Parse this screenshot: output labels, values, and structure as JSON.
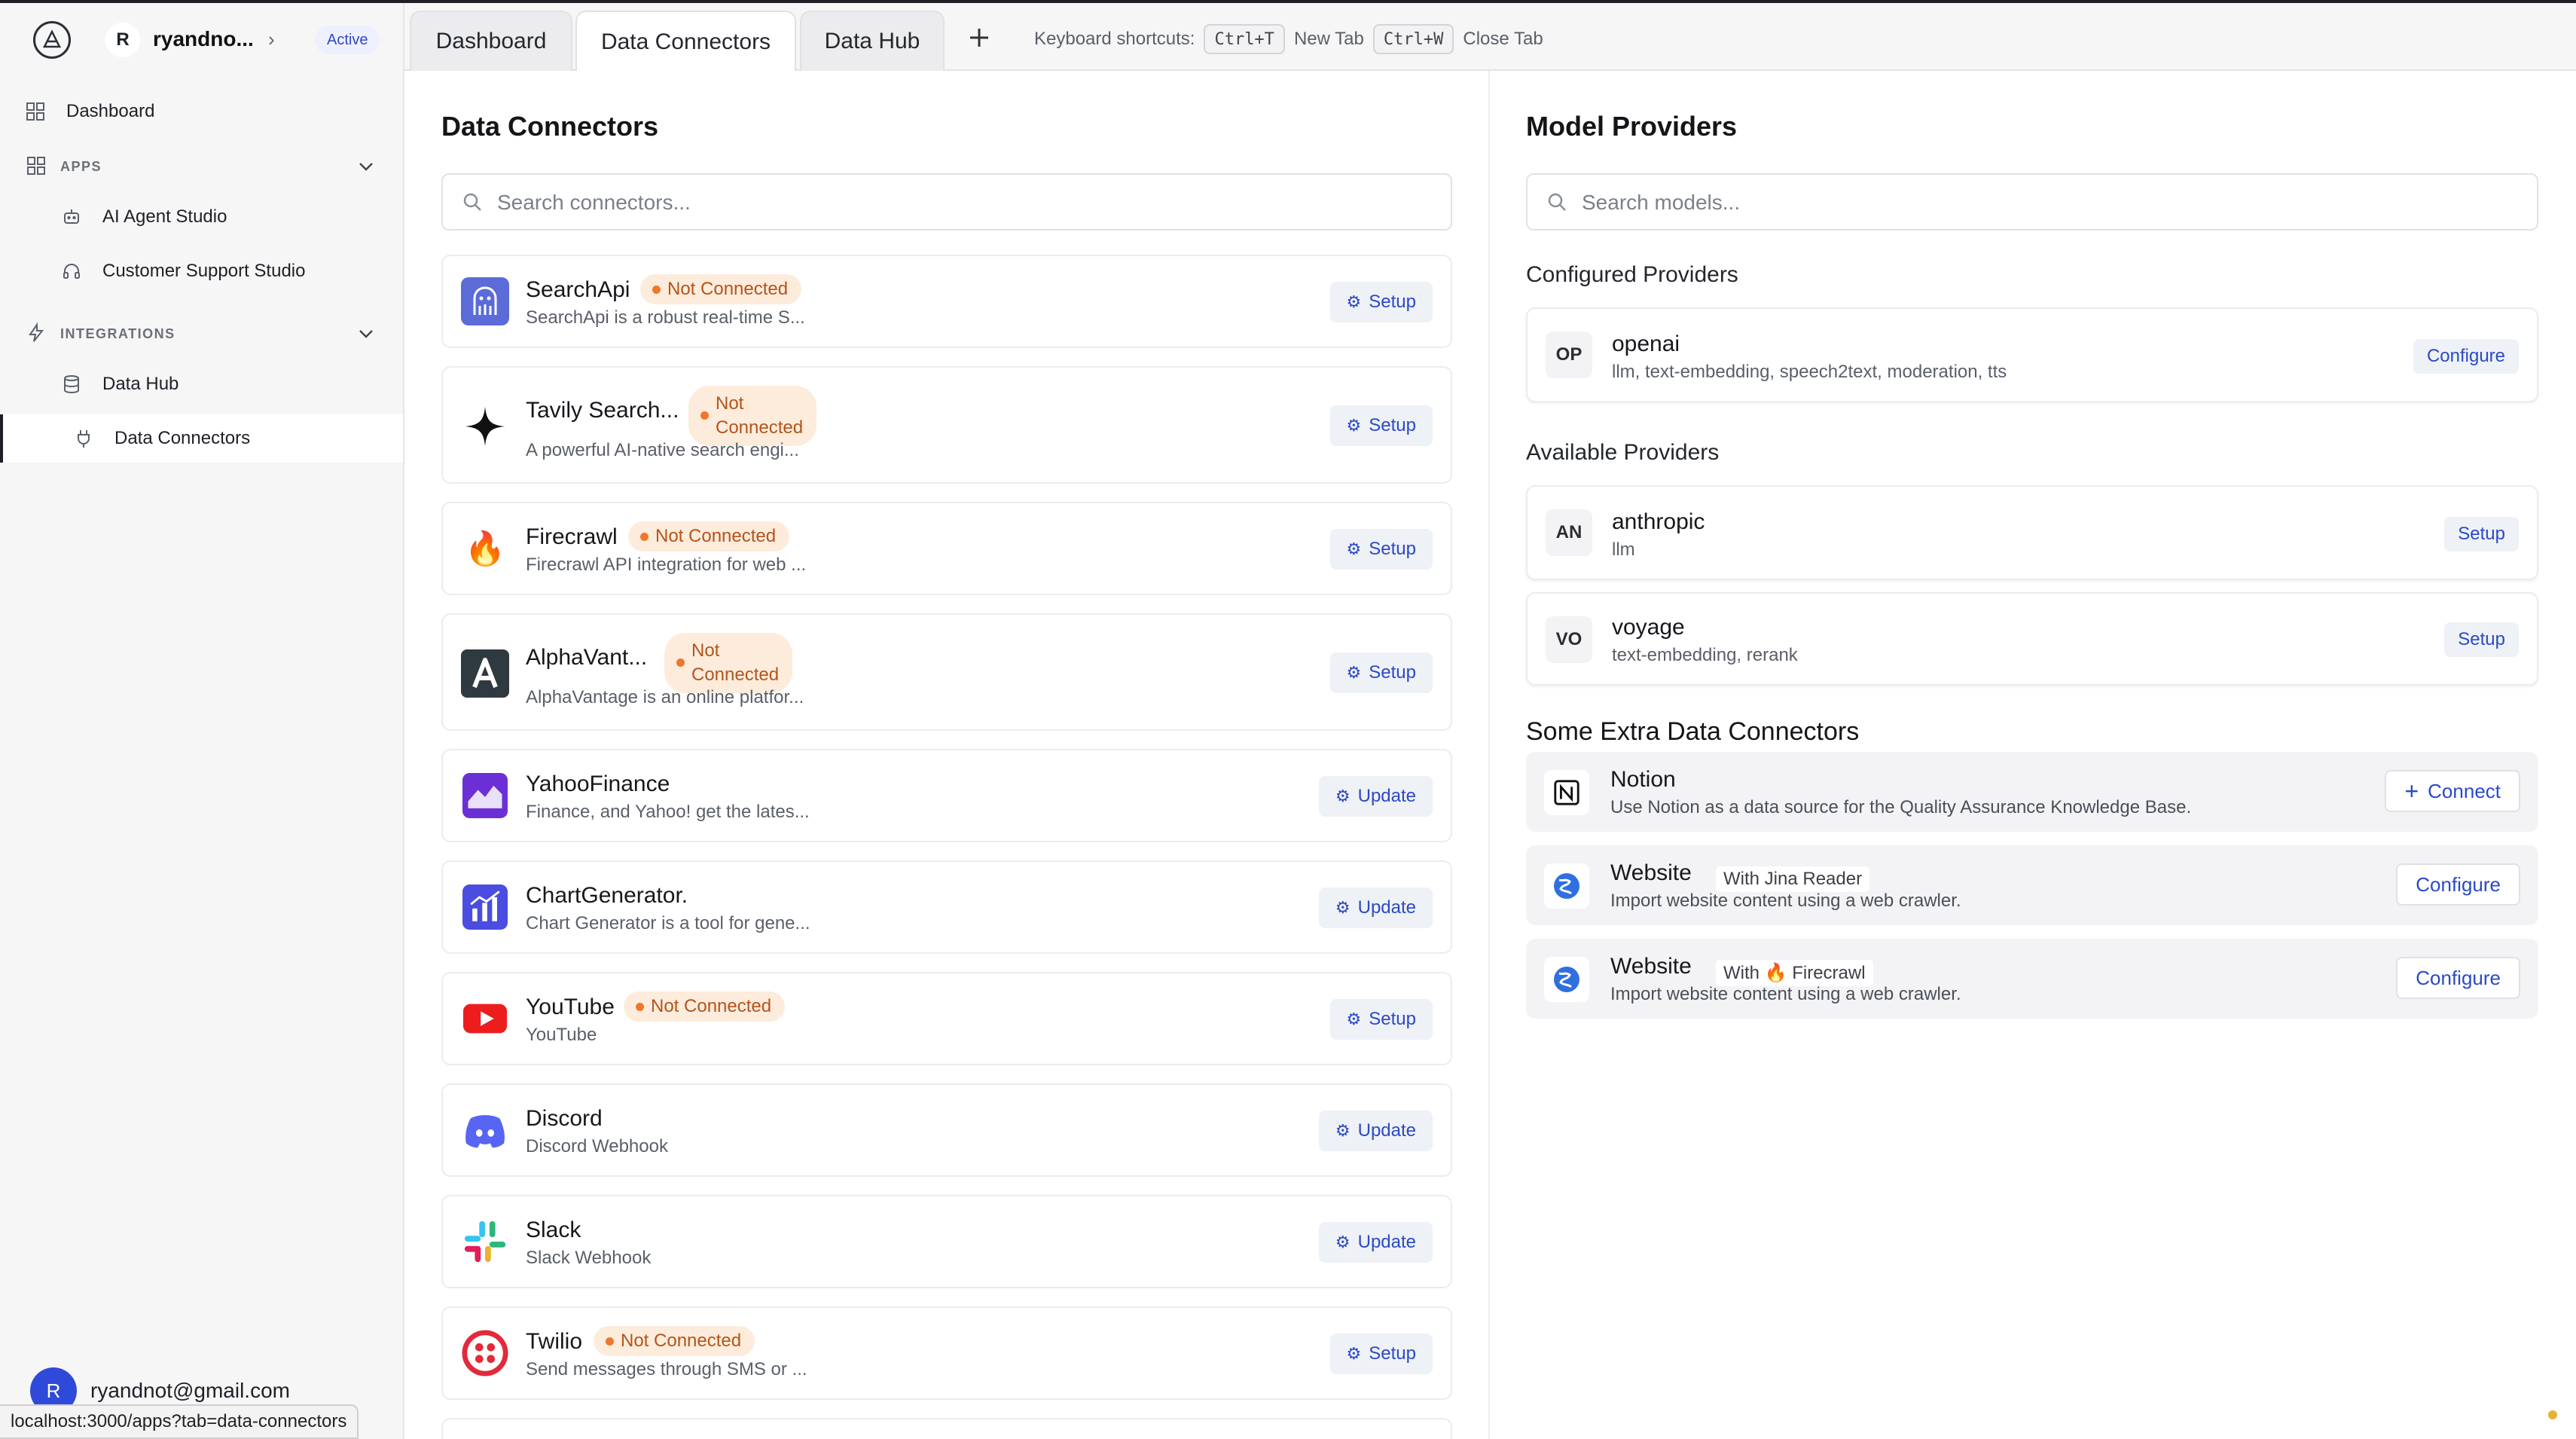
{
  "workspace": {
    "initial": "R",
    "name": "ryandno...",
    "status": "Active"
  },
  "sidebar": {
    "dashboard": "Dashboard",
    "apps_section": "APPS",
    "apps": [
      "AI Agent Studio",
      "Customer Support Studio"
    ],
    "integrations_section": "INTEGRATIONS",
    "integrations": [
      "Data Hub",
      "Data Connectors"
    ],
    "user_initial": "R",
    "user_email": "ryandnot@gmail.com"
  },
  "status_url": "localhost:3000/apps?tab=data-connectors",
  "tabs": [
    "Dashboard",
    "Data Connectors",
    "Data Hub"
  ],
  "shortcuts": {
    "label": "Keyboard shortcuts:",
    "new_key": "Ctrl+T",
    "new_label": "New Tab",
    "close_key": "Ctrl+W",
    "close_label": "Close Tab"
  },
  "connectors_panel": {
    "title": "Data Connectors",
    "search_placeholder": "Search connectors...",
    "items": [
      {
        "name": "SearchApi",
        "desc": "SearchApi is a robust real-time S...",
        "badge": "Not Connected",
        "action": "Setup",
        "icon": "octopus-icon"
      },
      {
        "name": "Tavily Search...",
        "desc": "A powerful AI-native search engi...",
        "badge_line1": "Not",
        "badge_line2": "Connected",
        "action": "Setup",
        "icon": "sparkle-icon"
      },
      {
        "name": "Firecrawl",
        "desc": "Firecrawl API integration for web ...",
        "badge": "Not Connected",
        "action": "Setup",
        "icon": "fire-icon"
      },
      {
        "name": "AlphaVant...",
        "desc": "AlphaVantage is an online platfor...",
        "badge_line1": "Not",
        "badge_line2": "Connected",
        "action": "Setup",
        "icon": "alphavantage-icon"
      },
      {
        "name": "YahooFinance",
        "desc": "Finance, and Yahoo! get the lates...",
        "action": "Update",
        "icon": "yahoo-finance-icon"
      },
      {
        "name": "ChartGenerator.",
        "desc": "Chart Generator is a tool for gene...",
        "action": "Update",
        "icon": "chart-icon"
      },
      {
        "name": "YouTube",
        "desc": "YouTube",
        "badge": "Not Connected",
        "action": "Setup",
        "icon": "youtube-icon"
      },
      {
        "name": "Discord",
        "desc": "Discord Webhook",
        "action": "Update",
        "icon": "discord-icon"
      },
      {
        "name": "Slack",
        "desc": "Slack Webhook",
        "action": "Update",
        "icon": "slack-icon"
      },
      {
        "name": "Twilio",
        "desc": "Send messages through SMS or ...",
        "badge": "Not Connected",
        "action": "Setup",
        "icon": "twilio-icon"
      }
    ]
  },
  "models_panel": {
    "title": "Model Providers",
    "search_placeholder": "Search models...",
    "configured_title": "Configured Providers",
    "configured": [
      {
        "abbr": "OP",
        "name": "openai",
        "desc": "llm, text-embedding, speech2text, moderation, tts",
        "action": "Configure"
      }
    ],
    "available_title": "Available Providers",
    "available": [
      {
        "abbr": "AN",
        "name": "anthropic",
        "desc": "llm",
        "action": "Setup"
      },
      {
        "abbr": "VO",
        "name": "voyage",
        "desc": "text-embedding, rerank",
        "action": "Setup"
      }
    ],
    "extra_title": "Some Extra Data Connectors",
    "extra": [
      {
        "name": "Notion",
        "desc": "Use Notion as a data source for the Quality Assurance Knowledge Base.",
        "action": "Connect"
      },
      {
        "name": "Website",
        "with": "With Jina Reader",
        "desc": "Import website content using a web crawler.",
        "action": "Configure"
      },
      {
        "name": "Website",
        "with": "With 🔥 Firecrawl",
        "desc": "Import website content using a web crawler.",
        "action": "Configure"
      }
    ]
  },
  "colors": {
    "accent": "#2b49c7",
    "badge_bg": "#fdecdc",
    "badge_text": "#b4541a",
    "badge_dot": "#f0762d"
  }
}
